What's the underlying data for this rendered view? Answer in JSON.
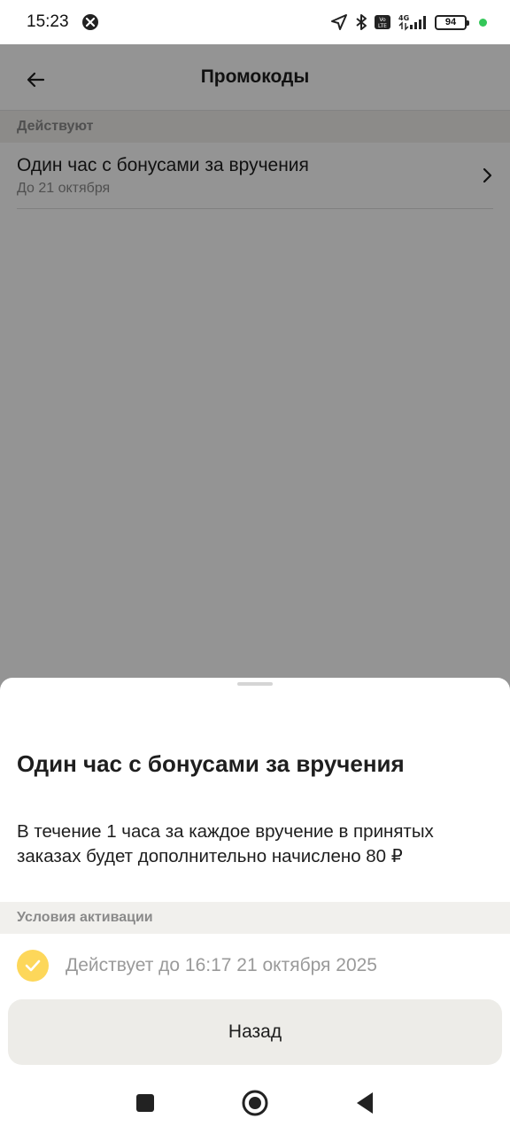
{
  "status_bar": {
    "time": "15:23",
    "network": "4G",
    "volte": "Vo LTE",
    "battery": "94"
  },
  "header": {
    "title": "Промокоды"
  },
  "section_active": "Действуют",
  "promo": {
    "title": "Один час с бонусами за вручения",
    "subtitle": "До 21 октября"
  },
  "sheet": {
    "title": "Один час с бонусами за вручения",
    "description": "В течение 1 часа за каждое вручение в принятых заказах будет дополнительно начислено 80 ₽",
    "conditions_label": "Условия активации",
    "condition": "Действует до 16:17 21 октября 2025",
    "back_button": "Назад"
  },
  "colors": {
    "accent": "#fdd75a",
    "scrim": "rgba(0,0,0,0.42)",
    "section_bg": "#f1f0ed",
    "button_bg": "#edece8"
  }
}
